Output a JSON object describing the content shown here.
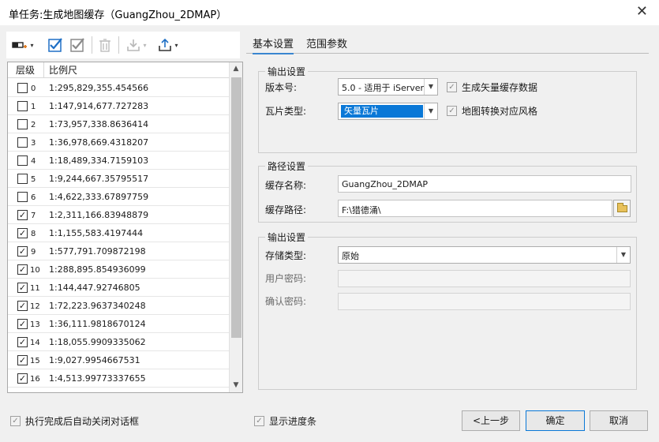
{
  "window": {
    "title": "单任务:生成地图缓存（GuangZhou_2DMAP）",
    "close_glyph": "✕"
  },
  "toolbar": {
    "caret": "▾"
  },
  "levels_list": {
    "headers": {
      "level": "层级",
      "scale": "比例尺"
    },
    "rows": [
      {
        "level": "0",
        "scale": "1:295,829,355.454566",
        "checked": false
      },
      {
        "level": "1",
        "scale": "1:147,914,677.727283",
        "checked": false
      },
      {
        "level": "2",
        "scale": "1:73,957,338.8636414",
        "checked": false
      },
      {
        "level": "3",
        "scale": "1:36,978,669.4318207",
        "checked": false
      },
      {
        "level": "4",
        "scale": "1:18,489,334.7159103",
        "checked": false
      },
      {
        "level": "5",
        "scale": "1:9,244,667.35795517",
        "checked": false
      },
      {
        "level": "6",
        "scale": "1:4,622,333.67897759",
        "checked": false
      },
      {
        "level": "7",
        "scale": "1:2,311,166.83948879",
        "checked": true
      },
      {
        "level": "8",
        "scale": "1:1,155,583.4197444",
        "checked": true
      },
      {
        "level": "9",
        "scale": "1:577,791.709872198",
        "checked": true
      },
      {
        "level": "10",
        "scale": "1:288,895.854936099",
        "checked": true
      },
      {
        "level": "11",
        "scale": "1:144,447.92746805",
        "checked": true
      },
      {
        "level": "12",
        "scale": "1:72,223.9637340248",
        "checked": true
      },
      {
        "level": "13",
        "scale": "1:36,111.9818670124",
        "checked": true
      },
      {
        "level": "14",
        "scale": "1:18,055.9909335062",
        "checked": true
      },
      {
        "level": "15",
        "scale": "1:9,027.9954667531",
        "checked": true
      },
      {
        "level": "16",
        "scale": "1:4,513.99773337655",
        "checked": true
      }
    ]
  },
  "tabs": [
    {
      "label": "基本设置",
      "active": true
    },
    {
      "label": "范围参数",
      "active": false
    }
  ],
  "output_settings": {
    "title": "输出设置",
    "version_label": "版本号:",
    "version_value": "5.0 - 适用于 iServer",
    "tile_type_label": "瓦片类型:",
    "tile_type_value": "矢量瓦片",
    "gen_vector_cache": {
      "label": "生成矢量缓存数据",
      "checked": true
    },
    "map_style_convert": {
      "label": "地图转换对应风格",
      "checked": true
    }
  },
  "path_settings": {
    "title": "路径设置",
    "cache_name_label": "缓存名称:",
    "cache_name_value": "GuangZhou_2DMAP",
    "cache_path_label": "缓存路径:",
    "cache_path_value": "F:\\猎德涌\\"
  },
  "storage_settings": {
    "title": "输出设置",
    "storage_type_label": "存储类型:",
    "storage_type_value": "原始",
    "user_password_label": "用户密码:",
    "confirm_password_label": "确认密码:"
  },
  "footer": {
    "auto_close": {
      "label": "执行完成后自动关闭对话框",
      "checked": true
    },
    "show_progress": {
      "label": "显示进度条",
      "checked": true
    },
    "prev_label": "<上一步",
    "ok_label": "确定",
    "cancel_label": "取消"
  },
  "colors": {
    "accent": "#0a78d7",
    "tab_underline": "#3a86d0",
    "check_blue": "#1f6fc5",
    "folder": "#e8c15a"
  },
  "icons": [
    "select-layer-icon",
    "check-all-icon",
    "check-selected-icon",
    "delete-icon",
    "import-icon",
    "export-icon",
    "folder-icon"
  ]
}
